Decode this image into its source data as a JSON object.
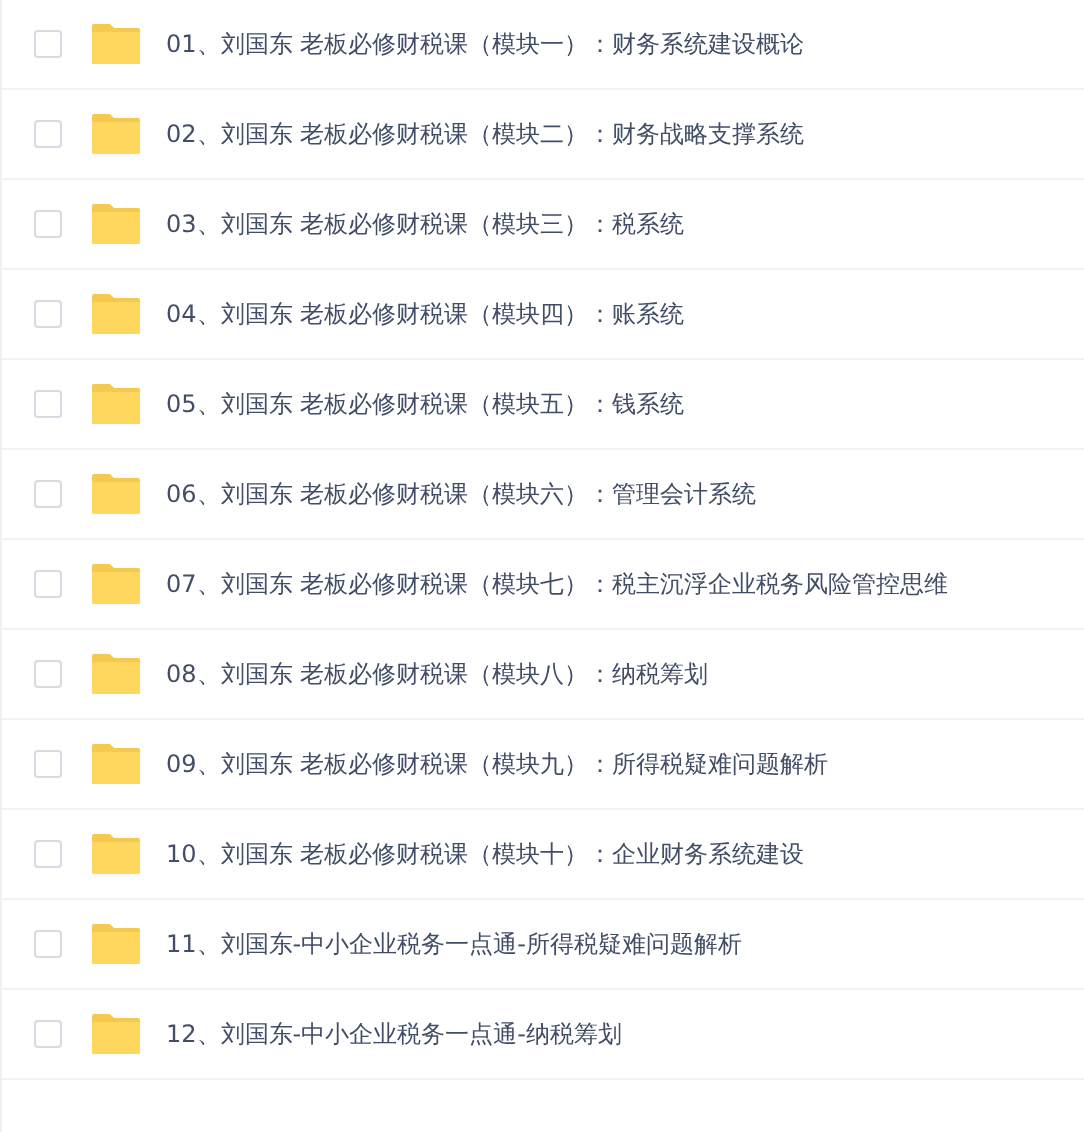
{
  "files": [
    {
      "name": "01、刘国东 老板必修财税课（模块一）：财务系统建设概论",
      "checked": false
    },
    {
      "name": "02、刘国东 老板必修财税课（模块二）：财务战略支撑系统",
      "checked": false
    },
    {
      "name": "03、刘国东 老板必修财税课（模块三）：税系统",
      "checked": false
    },
    {
      "name": "04、刘国东 老板必修财税课（模块四）：账系统",
      "checked": false
    },
    {
      "name": "05、刘国东 老板必修财税课（模块五）：钱系统",
      "checked": false
    },
    {
      "name": "06、刘国东 老板必修财税课（模块六）：管理会计系统",
      "checked": false
    },
    {
      "name": "07、刘国东 老板必修财税课（模块七）：税主沉浮企业税务风险管控思维",
      "checked": false
    },
    {
      "name": "08、刘国东 老板必修财税课（模块八）：纳税筹划",
      "checked": false
    },
    {
      "name": "09、刘国东 老板必修财税课（模块九）：所得税疑难问题解析",
      "checked": false
    },
    {
      "name": "10、刘国东 老板必修财税课（模块十）：企业财务系统建设",
      "checked": false
    },
    {
      "name": "11、刘国东-中小企业税务一点通-所得税疑难问题解析",
      "checked": false
    },
    {
      "name": "12、刘国东-中小企业税务一点通-纳税筹划",
      "checked": false
    }
  ]
}
